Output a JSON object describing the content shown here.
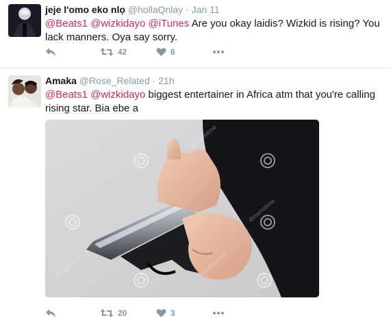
{
  "tweets": [
    {
      "name": "jeje l'omo eko nlọ",
      "handle": "@hollaQnlay",
      "time": "Jan 11",
      "text_parts": [
        {
          "text": "@Beats1",
          "mention": true
        },
        {
          "text": " ",
          "mention": false
        },
        {
          "text": "@wizkidayo",
          "mention": true
        },
        {
          "text": " ",
          "mention": false
        },
        {
          "text": "@iTunes",
          "mention": true
        },
        {
          "text": " Are you okay laidis? Wizkid is rising? You lack manners. Oya say sorry.",
          "mention": false
        }
      ],
      "retweets": "42",
      "likes": "6"
    },
    {
      "name": "Amaka",
      "handle": "@Rose_Related",
      "time": "21h",
      "text_parts": [
        {
          "text": "@Beats1",
          "mention": true
        },
        {
          "text": " ",
          "mention": false
        },
        {
          "text": "@wizkidayo",
          "mention": true
        },
        {
          "text": " biggest entertainer in Africa atm that you're calling rising star. Bia ebe a",
          "mention": false
        }
      ],
      "retweets": "20",
      "likes": "3",
      "media_watermark": "dreamstime"
    }
  ],
  "separator": "·",
  "icons": {
    "reply": "reply-icon",
    "retweet": "retweet-icon",
    "like": "heart-icon",
    "more": "more-icon"
  },
  "colors": {
    "mention": "#e0245e",
    "muted": "#8899a6",
    "text": "#14171a",
    "divider": "#e6ecf0"
  }
}
